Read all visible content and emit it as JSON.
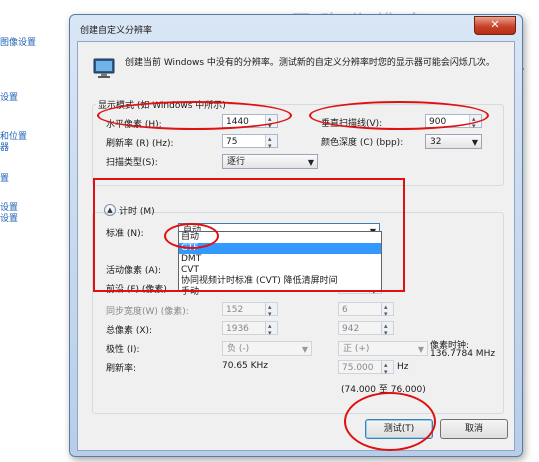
{
  "background": {
    "left_links": [
      "图像设置",
      "设置",
      "和位置",
      "器",
      "置",
      "设置",
      "设置"
    ],
    "right_fragment": "。",
    "blurred_title": "更 改 分 辨 率"
  },
  "dialog": {
    "title": "创建自定义分辨率",
    "close_symbol": "✕",
    "intro": "创建当前 Windows 中没有的分辨率。测试新的自定义分辨率时您的显示器可能会闪烁几次。",
    "display_mode": {
      "legend": "显示模式 (如 Windows 中所示)",
      "h_pixels_label": "水平像素 (H):",
      "h_pixels_value": "1440",
      "v_scanlines_label": "垂直扫描线(V):",
      "v_scanlines_value": "900",
      "refresh_label": "刷新率 (R) (Hz):",
      "refresh_value": "75",
      "color_depth_label": "颜色深度 (C) (bpp):",
      "color_depth_value": "32",
      "scan_type_label": "扫描类型(S):",
      "scan_type_value": "逐行"
    },
    "timing": {
      "legend": "计时 (M)",
      "expander_symbol": "▲",
      "standard_label": "标准 (N):",
      "standard_value": "自动",
      "options": [
        "自动",
        "GTF",
        "DMT",
        "CVT",
        "协同视频计时标准 (CVT) 降低清屏时间",
        "手动"
      ],
      "selected_option": "GTF",
      "active_pixels_label": "活动像素 (A):",
      "front_porch_label": "前沿 (F) (像素)",
      "sync_width_label": "同步宽度(W) (像素):",
      "sync_width_h": "152",
      "sync_width_v": "6",
      "total_pixels_label": "总像素 (X):",
      "total_pixels_h": "1936",
      "total_pixels_v": "942",
      "polarity_label": "极性 (I):",
      "polarity_h": "负 (-)",
      "polarity_v": "正 (+)",
      "pixel_clock_label": "像素时钟:",
      "pixel_clock_value": "136.7784 MHz",
      "refresh_label": "刷新率:",
      "refresh_h_value": "70.65 KHz",
      "refresh_v_value": "75.000",
      "refresh_v_unit": "Hz",
      "refresh_range": "(74.000 至 76.000)"
    },
    "buttons": {
      "test": "测试(T)",
      "cancel": "取消"
    }
  },
  "annotations_color": "#e01010"
}
